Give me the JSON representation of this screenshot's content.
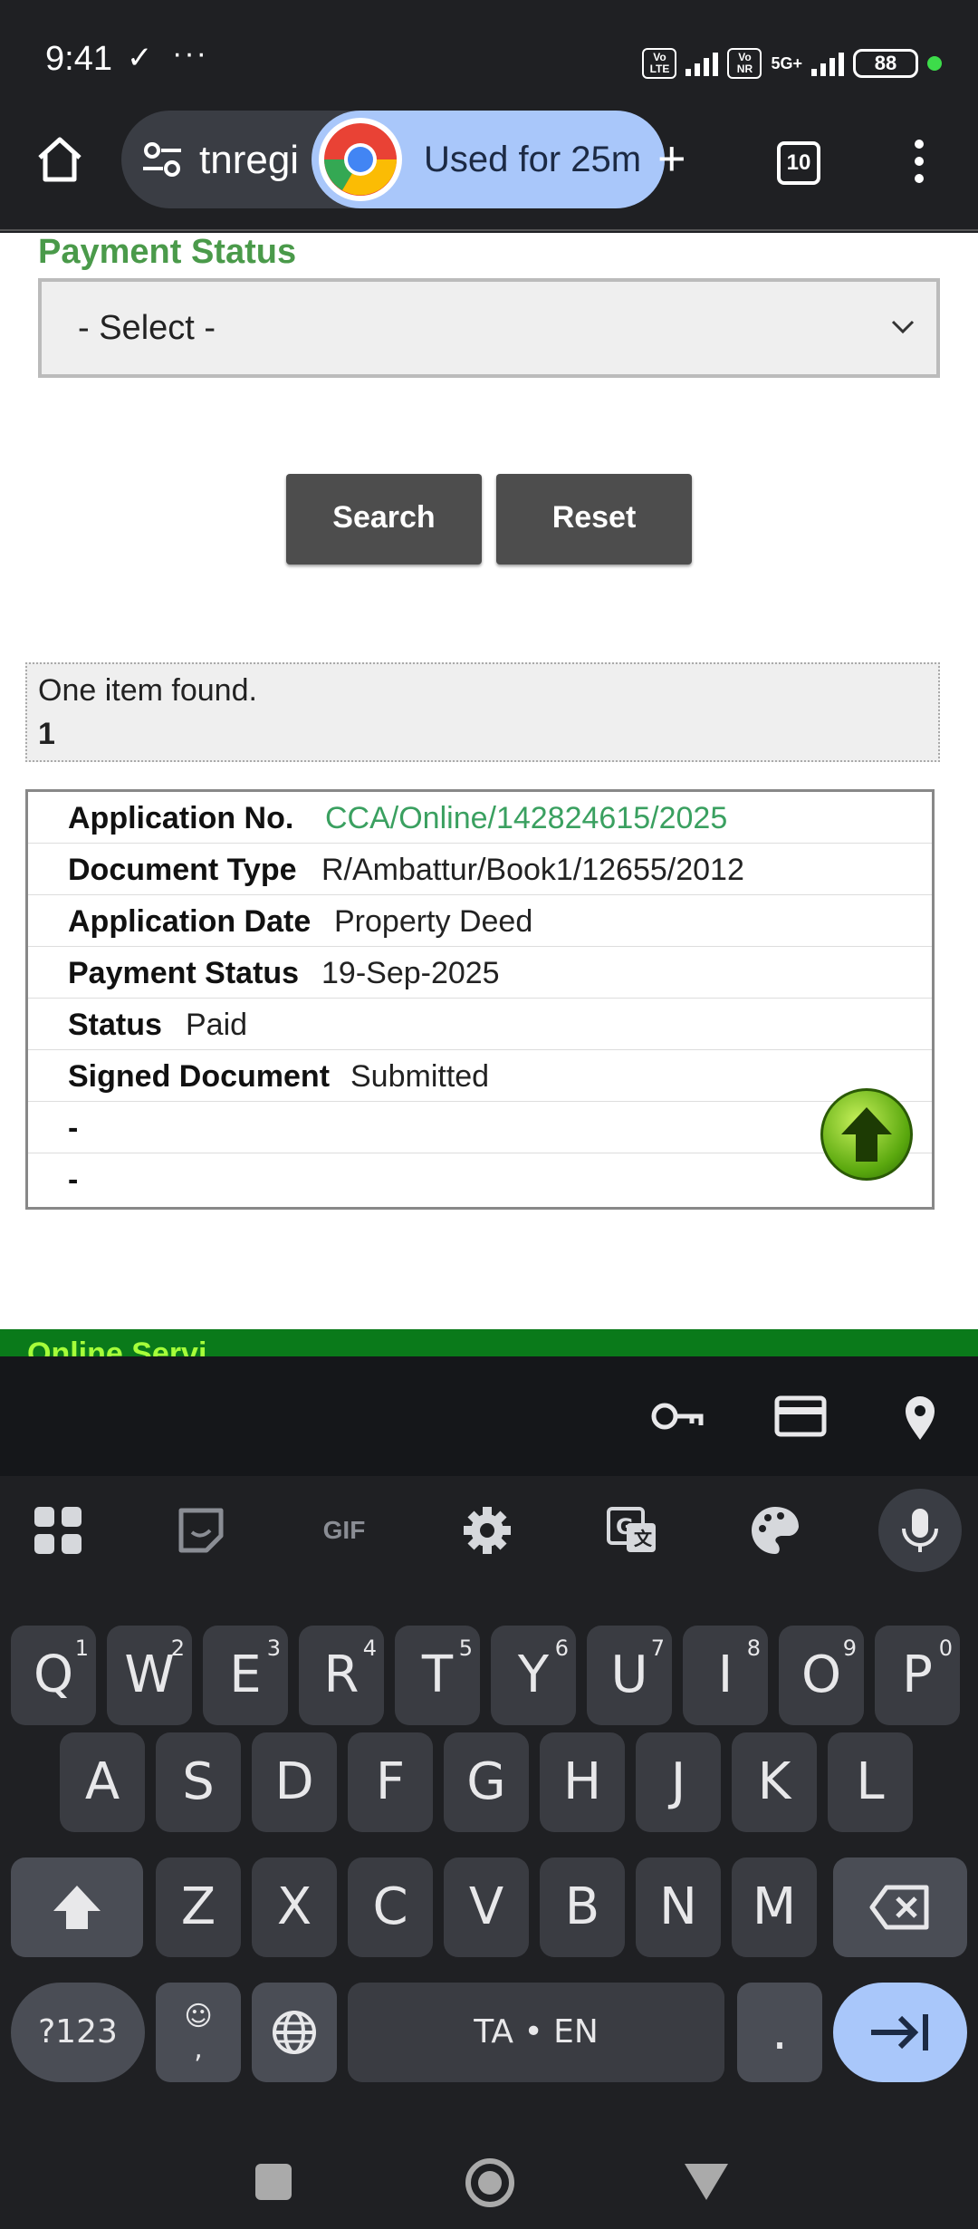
{
  "status_bar": {
    "time": "9:41",
    "battery": "88",
    "network": "5G+",
    "chip1": "Vo LTE",
    "chip2": "Vo NR"
  },
  "browser": {
    "url_text": "tnregi",
    "usage_text": "Used for 25m",
    "tab_count": "10"
  },
  "form": {
    "payment_status_label": "Payment Status",
    "select_value": "- Select -",
    "search_button": "Search",
    "reset_button": "Reset"
  },
  "results": {
    "found_text": "One item found.",
    "page_number": "1",
    "rows": [
      {
        "label": "Application No.",
        "value": "CCA/Online/142824615/2025"
      },
      {
        "label": "Document Type",
        "value": "R/Ambattur/Book1/12655/2012"
      },
      {
        "label": "Application Date",
        "value": "Property Deed"
      },
      {
        "label": "Payment Status",
        "value": "19-Sep-2025"
      },
      {
        "label": "Status",
        "value": "Paid"
      },
      {
        "label": "Signed Document",
        "value": "Submitted"
      },
      {
        "label": "-",
        "value": ""
      },
      {
        "label": "-",
        "value": ""
      }
    ]
  },
  "footer_band_text": "Online Servi",
  "keyboard": {
    "tools": {
      "gif": "GIF"
    },
    "row1": [
      {
        "k": "Q",
        "n": "1"
      },
      {
        "k": "W",
        "n": "2"
      },
      {
        "k": "E",
        "n": "3"
      },
      {
        "k": "R",
        "n": "4"
      },
      {
        "k": "T",
        "n": "5"
      },
      {
        "k": "Y",
        "n": "6"
      },
      {
        "k": "U",
        "n": "7"
      },
      {
        "k": "I",
        "n": "8"
      },
      {
        "k": "O",
        "n": "9"
      },
      {
        "k": "P",
        "n": "0"
      }
    ],
    "row2": [
      "A",
      "S",
      "D",
      "F",
      "G",
      "H",
      "J",
      "K",
      "L"
    ],
    "row3": [
      "Z",
      "X",
      "C",
      "V",
      "B",
      "N",
      "M"
    ],
    "symbols_key": "?123",
    "emoji_key": "☺\n,",
    "space_key": "TA • EN",
    "period_key": "."
  }
}
